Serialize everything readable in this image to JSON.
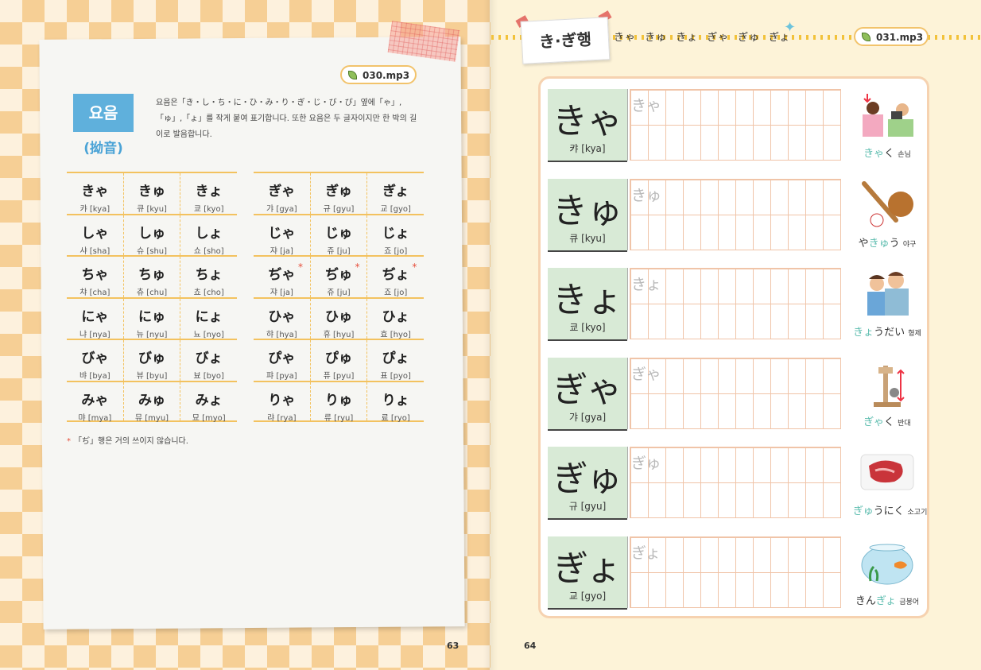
{
  "left_page": {
    "audio": "030.mp3",
    "section_label": "요음",
    "section_kanji": "(拗音)",
    "intro": "요음은「き・し・ち・に・ひ・み・り・ぎ・じ・び・ぴ」옆에「ゃ」,「ゅ」,「ょ」를 작게 붙여 표기합니다. 또한 요음은 두 글자이지만 한 박의 길이로 발음합니다.",
    "table1": [
      [
        {
          "k": "きゃ",
          "r": "캬 [kya]"
        },
        {
          "k": "きゅ",
          "r": "큐 [kyu]"
        },
        {
          "k": "きょ",
          "r": "쿄 [kyo]"
        }
      ],
      [
        {
          "k": "しゃ",
          "r": "샤 [sha]"
        },
        {
          "k": "しゅ",
          "r": "슈 [shu]"
        },
        {
          "k": "しょ",
          "r": "쇼 [sho]"
        }
      ],
      [
        {
          "k": "ちゃ",
          "r": "챠 [cha]"
        },
        {
          "k": "ちゅ",
          "r": "츄 [chu]"
        },
        {
          "k": "ちょ",
          "r": "쵸 [cho]"
        }
      ],
      [
        {
          "k": "にゃ",
          "r": "냐 [nya]"
        },
        {
          "k": "にゅ",
          "r": "뉴 [nyu]"
        },
        {
          "k": "にょ",
          "r": "뇨 [nyo]"
        }
      ],
      [
        {
          "k": "びゃ",
          "r": "뱌 [bya]"
        },
        {
          "k": "びゅ",
          "r": "뷰 [byu]"
        },
        {
          "k": "びょ",
          "r": "뵤 [byo]"
        }
      ],
      [
        {
          "k": "みゃ",
          "r": "먀 [mya]"
        },
        {
          "k": "みゅ",
          "r": "뮤 [myu]"
        },
        {
          "k": "みょ",
          "r": "묘 [myo]"
        }
      ]
    ],
    "table2": [
      [
        {
          "k": "ぎゃ",
          "r": "갸 [gya]"
        },
        {
          "k": "ぎゅ",
          "r": "규 [gyu]"
        },
        {
          "k": "ぎょ",
          "r": "교 [gyo]"
        }
      ],
      [
        {
          "k": "じゃ",
          "r": "쟈 [ja]"
        },
        {
          "k": "じゅ",
          "r": "쥬 [ju]"
        },
        {
          "k": "じょ",
          "r": "죠 [jo]"
        }
      ],
      [
        {
          "k": "ぢゃ",
          "r": "쟈 [ja]"
        },
        {
          "k": "ぢゅ",
          "r": "쥬 [ju]"
        },
        {
          "k": "ぢょ",
          "r": "죠 [jo]"
        }
      ],
      [
        {
          "k": "ひゃ",
          "r": "햐 [hya]"
        },
        {
          "k": "ひゅ",
          "r": "휴 [hyu]"
        },
        {
          "k": "ひょ",
          "r": "효 [hyo]"
        }
      ],
      [
        {
          "k": "ぴゃ",
          "r": "퍄 [pya]"
        },
        {
          "k": "ぴゅ",
          "r": "퓨 [pyu]"
        },
        {
          "k": "ぴょ",
          "r": "표 [pyo]"
        }
      ],
      [
        {
          "k": "りゃ",
          "r": "랴 [rya]"
        },
        {
          "k": "りゅ",
          "r": "류 [ryu]"
        },
        {
          "k": "りょ",
          "r": "료 [ryo]"
        }
      ]
    ],
    "asterisk": "*",
    "note": "「ぢ」행은 거의 쓰이지 않습니다.",
    "page_number": "63"
  },
  "right_page": {
    "heading": "き·ぎ행",
    "heading_row": "きゃ きゅ きょ ぎゃ ぎゅ ぎょ",
    "audio": "031.mp3",
    "rows": [
      {
        "kana": "きゃ",
        "rom": "캬 [kya]",
        "trace": "きゃ",
        "word_pre": "",
        "word_hl": "きゃ",
        "word_post": "く",
        "meaning": "손님"
      },
      {
        "kana": "きゅ",
        "rom": "큐 [kyu]",
        "trace": "きゅ",
        "word_pre": "や",
        "word_hl": "きゅ",
        "word_post": "う",
        "meaning": "야구"
      },
      {
        "kana": "きょ",
        "rom": "쿄 [kyo]",
        "trace": "きょ",
        "word_pre": "",
        "word_hl": "きょ",
        "word_post": "うだい",
        "meaning": "형제"
      },
      {
        "kana": "ぎゃ",
        "rom": "갸 [gya]",
        "trace": "ぎゃ",
        "word_pre": "",
        "word_hl": "ぎゃ",
        "word_post": "く",
        "meaning": "반대"
      },
      {
        "kana": "ぎゅ",
        "rom": "규 [gyu]",
        "trace": "ぎゅ",
        "word_pre": "",
        "word_hl": "ぎゅ",
        "word_post": "うにく",
        "meaning": "소고기"
      },
      {
        "kana": "ぎょ",
        "rom": "교 [gyo]",
        "trace": "ぎょ",
        "word_pre": "きん",
        "word_hl": "ぎょ",
        "word_post": "",
        "meaning": "금붕어"
      }
    ],
    "page_number": "64"
  }
}
